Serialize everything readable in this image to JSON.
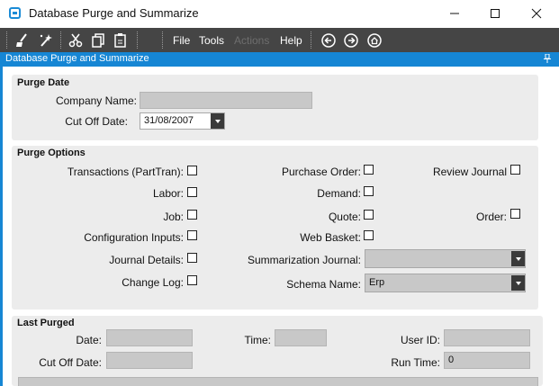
{
  "window": {
    "title": "Database Purge and Summarize"
  },
  "toolbar": {
    "menus": {
      "file": "File",
      "tools": "Tools",
      "actions": "Actions",
      "help": "Help"
    }
  },
  "panel": {
    "title": "Database Purge and Summarize"
  },
  "purge_date": {
    "heading": "Purge Date",
    "company_name_label": "Company Name:",
    "company_name_value": "",
    "cut_off_date_label": "Cut Off Date:",
    "cut_off_date_value": "31/08/2007"
  },
  "purge_options": {
    "heading": "Purge Options",
    "transactions": "Transactions (PartTran):",
    "labor": "Labor:",
    "job": "Job:",
    "configuration_inputs": "Configuration Inputs:",
    "journal_details": "Journal Details:",
    "change_log": "Change Log:",
    "purchase_order": "Purchase Order:",
    "demand": "Demand:",
    "quote": "Quote:",
    "web_basket": "Web Basket:",
    "summarization_journal_label": "Summarization Journal:",
    "summarization_journal_value": "",
    "schema_name_label": "Schema Name:",
    "schema_name_value": "Erp",
    "review_journal": "Review Journal",
    "order": "Order:"
  },
  "last_purged": {
    "heading": "Last Purged",
    "date_label": "Date:",
    "date_value": "",
    "time_label": "Time:",
    "time_value": "",
    "user_id_label": "User ID:",
    "user_id_value": "",
    "cut_off_date_label": "Cut Off Date:",
    "cut_off_date_value": "",
    "run_time_label": "Run Time:",
    "run_time_value": "0"
  },
  "colors": {
    "accent": "#1686d4",
    "toolbar": "#454545",
    "group_bg": "#ececec"
  }
}
